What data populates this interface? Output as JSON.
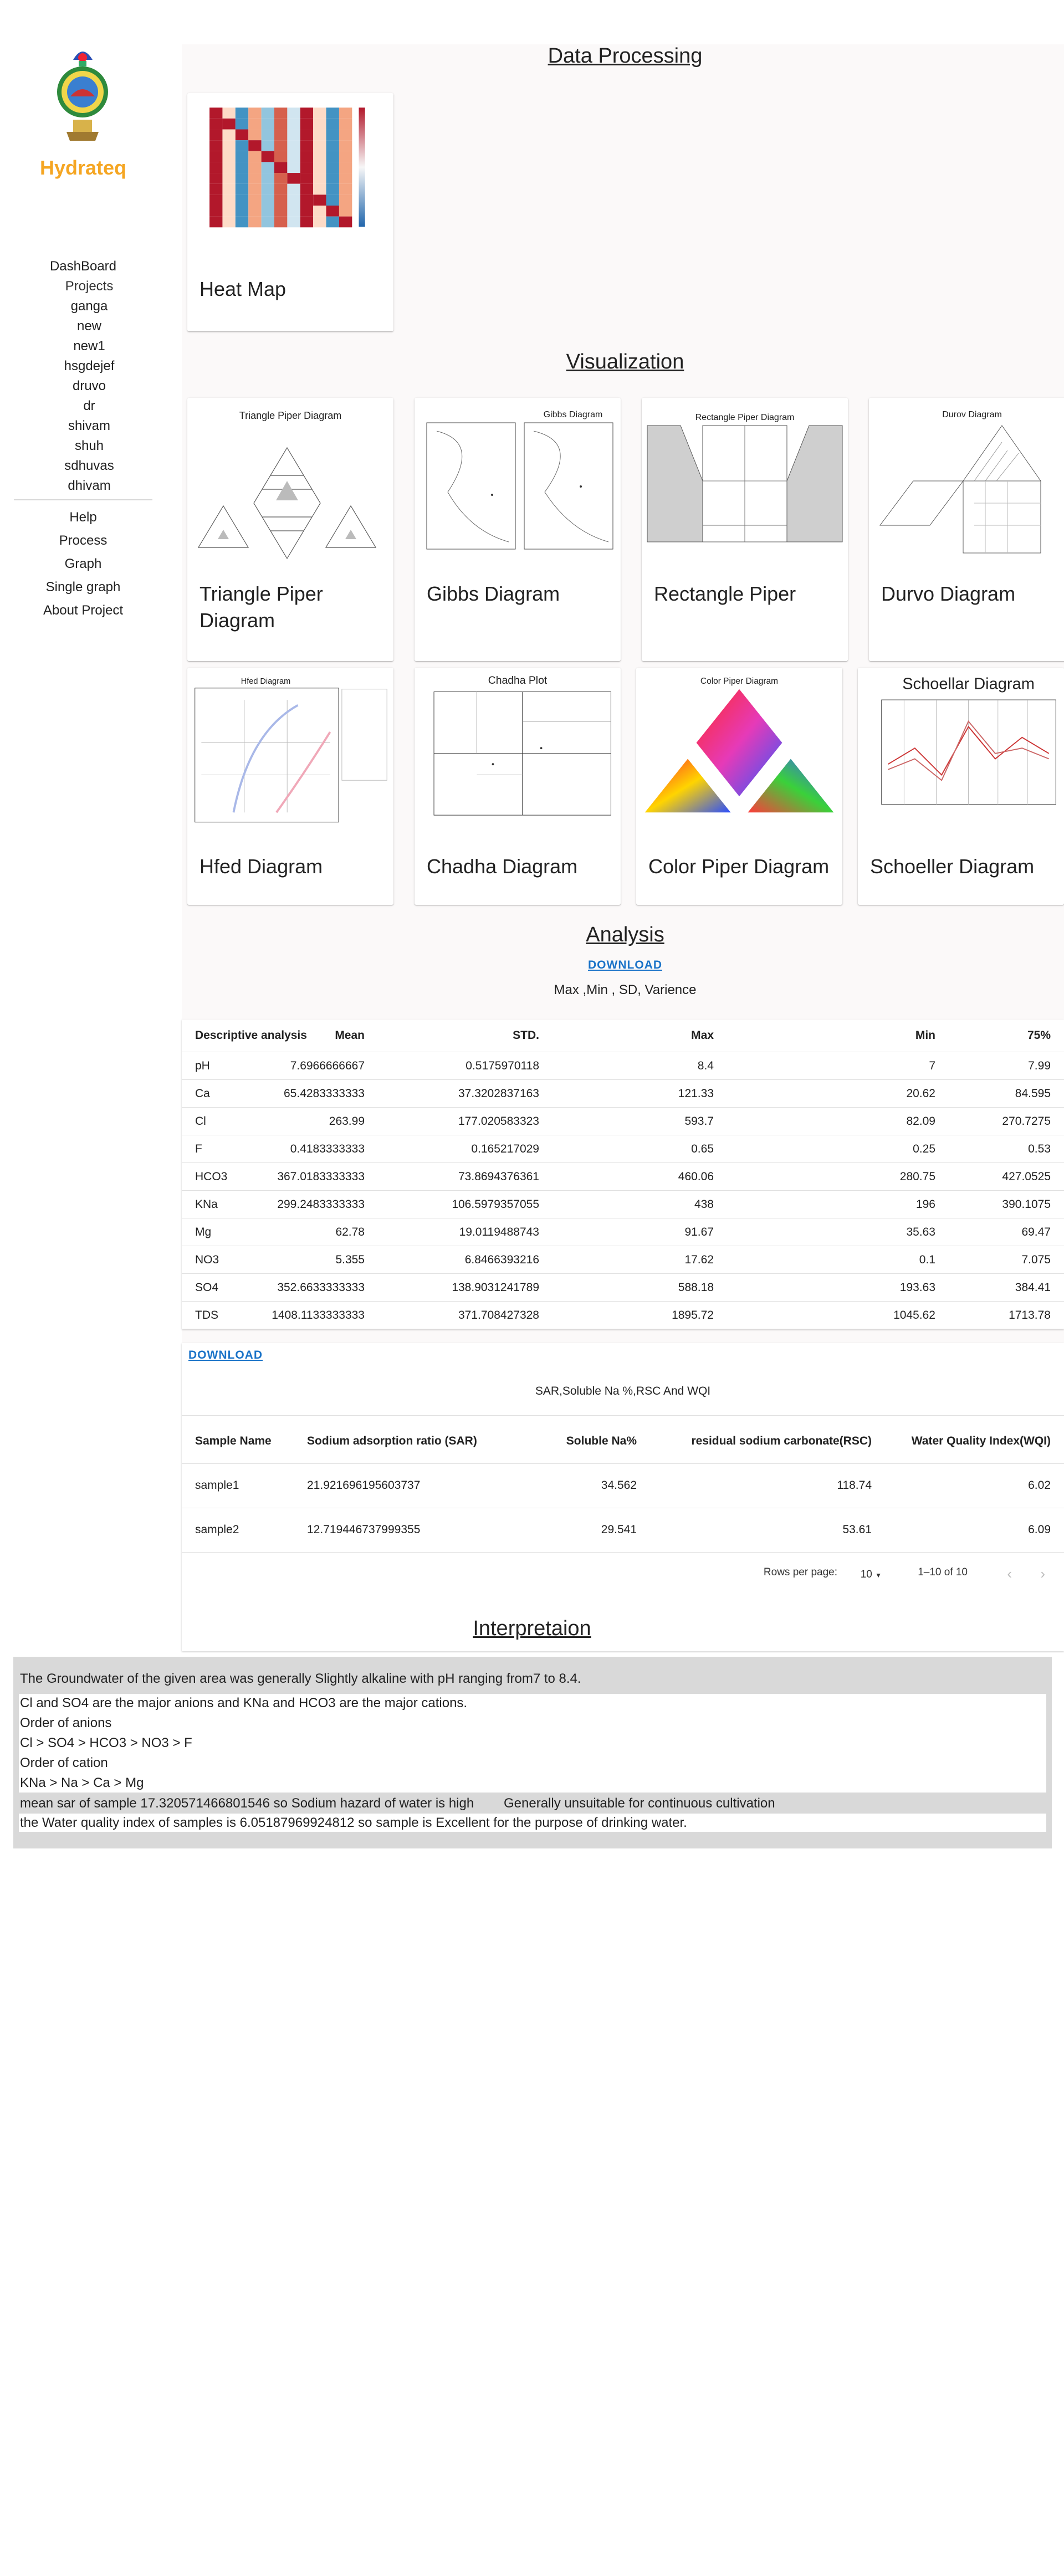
{
  "sidebar": {
    "brand": "Hydrateq",
    "dashboard": "DashBoard",
    "projects_label": "Projects",
    "projects": [
      "ganga",
      "new",
      "new1",
      "hsgdejef",
      "druvo",
      "dr",
      "shivam",
      "shuh",
      "sdhuvas",
      "dhivam"
    ],
    "menu": [
      "Help",
      "Process",
      "Graph",
      "Single graph",
      "About Project"
    ]
  },
  "data_processing": {
    "title": "Data Processing",
    "card_title": "Heat Map"
  },
  "visualization": {
    "title": "Visualization",
    "cards": [
      {
        "title": "Triangle Piper Diagram",
        "thumb_caption": "Triangle Piper Diagram"
      },
      {
        "title": "Gibbs Diagram",
        "thumb_caption": "Gibbs Diagram"
      },
      {
        "title": "Rectangle Piper",
        "thumb_caption": "Rectangle Piper Diagram"
      },
      {
        "title": "Durvo Diagram",
        "thumb_caption": "Durov Diagram"
      },
      {
        "title": "Hfed Diagram",
        "thumb_caption": "Hfed Diagram"
      },
      {
        "title": "Chadha Diagram",
        "thumb_caption": "Chadha Plot"
      },
      {
        "title": "Color Piper Diagram",
        "thumb_caption": "Color Piper Diagram"
      },
      {
        "title": "Schoeller Diagram",
        "thumb_caption": "Schoellar Diagram"
      }
    ]
  },
  "analysis": {
    "title": "Analysis",
    "download": "DOWNLOAD",
    "subtitle": "Max ,Min , SD, Varience",
    "headers": [
      "Descriptive analysis",
      "Mean",
      "STD.",
      "Max",
      "Min",
      "75%"
    ],
    "rows": [
      [
        "pH",
        "7.6966666667",
        "0.5175970118",
        "8.4",
        "7",
        "7.99"
      ],
      [
        "Ca",
        "65.4283333333",
        "37.3202837163",
        "121.33",
        "20.62",
        "84.595"
      ],
      [
        "Cl",
        "263.99",
        "177.020583323",
        "593.7",
        "82.09",
        "270.7275"
      ],
      [
        "F",
        "0.4183333333",
        "0.165217029",
        "0.65",
        "0.25",
        "0.53"
      ],
      [
        "HCO3",
        "367.0183333333",
        "73.8694376361",
        "460.06",
        "280.75",
        "427.0525"
      ],
      [
        "KNa",
        "299.2483333333",
        "106.5979357055",
        "438",
        "196",
        "390.1075"
      ],
      [
        "Mg",
        "62.78",
        "19.0119488743",
        "91.67",
        "35.63",
        "69.47"
      ],
      [
        "NO3",
        "5.355",
        "6.8466393216",
        "17.62",
        "0.1",
        "7.075"
      ],
      [
        "SO4",
        "352.6633333333",
        "138.9031241789",
        "588.18",
        "193.63",
        "384.41"
      ],
      [
        "TDS",
        "1408.1133333333",
        "371.708427328",
        "1895.72",
        "1045.62",
        "1713.78"
      ]
    ]
  },
  "sar_table": {
    "download": "DOWNLOAD",
    "title": "SAR,Soluble Na %,RSC And WQI",
    "headers": [
      "Sample Name",
      "Sodium adsorption ratio (SAR)",
      "Soluble Na%",
      "residual sodium carbonate(RSC)",
      "Water Quality Index(WQI)"
    ],
    "rows": [
      [
        "sample1",
        "21.921696195603737",
        "34.562",
        "118.74",
        "6.02"
      ],
      [
        "sample2",
        "12.719446737999355",
        "29.541",
        "53.61",
        "6.09"
      ]
    ],
    "pagination": {
      "rows_label": "Rows per page:",
      "rows_value": "10",
      "range": "1–10 of 10"
    }
  },
  "interpretation": {
    "title": "Interpretaion",
    "lines": [
      "The Groundwater of the given area was generally Slightly alkaline with pH ranging from7 to 8.4.",
      "Cl and SO4 are the major anions and KNa and HCO3 are the major cations.",
      "Order of anions",
      "Cl > SO4 > HCO3 > NO3 > F",
      "Order of cation",
      "KNa > Na > Ca > Mg",
      "mean sar of sample 17.320571466801546 so Sodium hazard of water is high",
      "Generally unsuitable for continuous cultivation",
      "the Water quality index of samples is 6.05187969924812 so sample is Excellent for the purpose of drinking water."
    ]
  },
  "colors": {
    "brand": "#f5a623",
    "link": "#1a73c8",
    "panel_bg": "#fbf9f9",
    "interp_bg": "#d9d9d9"
  },
  "icons": [
    "emblem-logo",
    "chevron-left-icon",
    "chevron-right-icon",
    "dropdown-arrow-icon"
  ]
}
